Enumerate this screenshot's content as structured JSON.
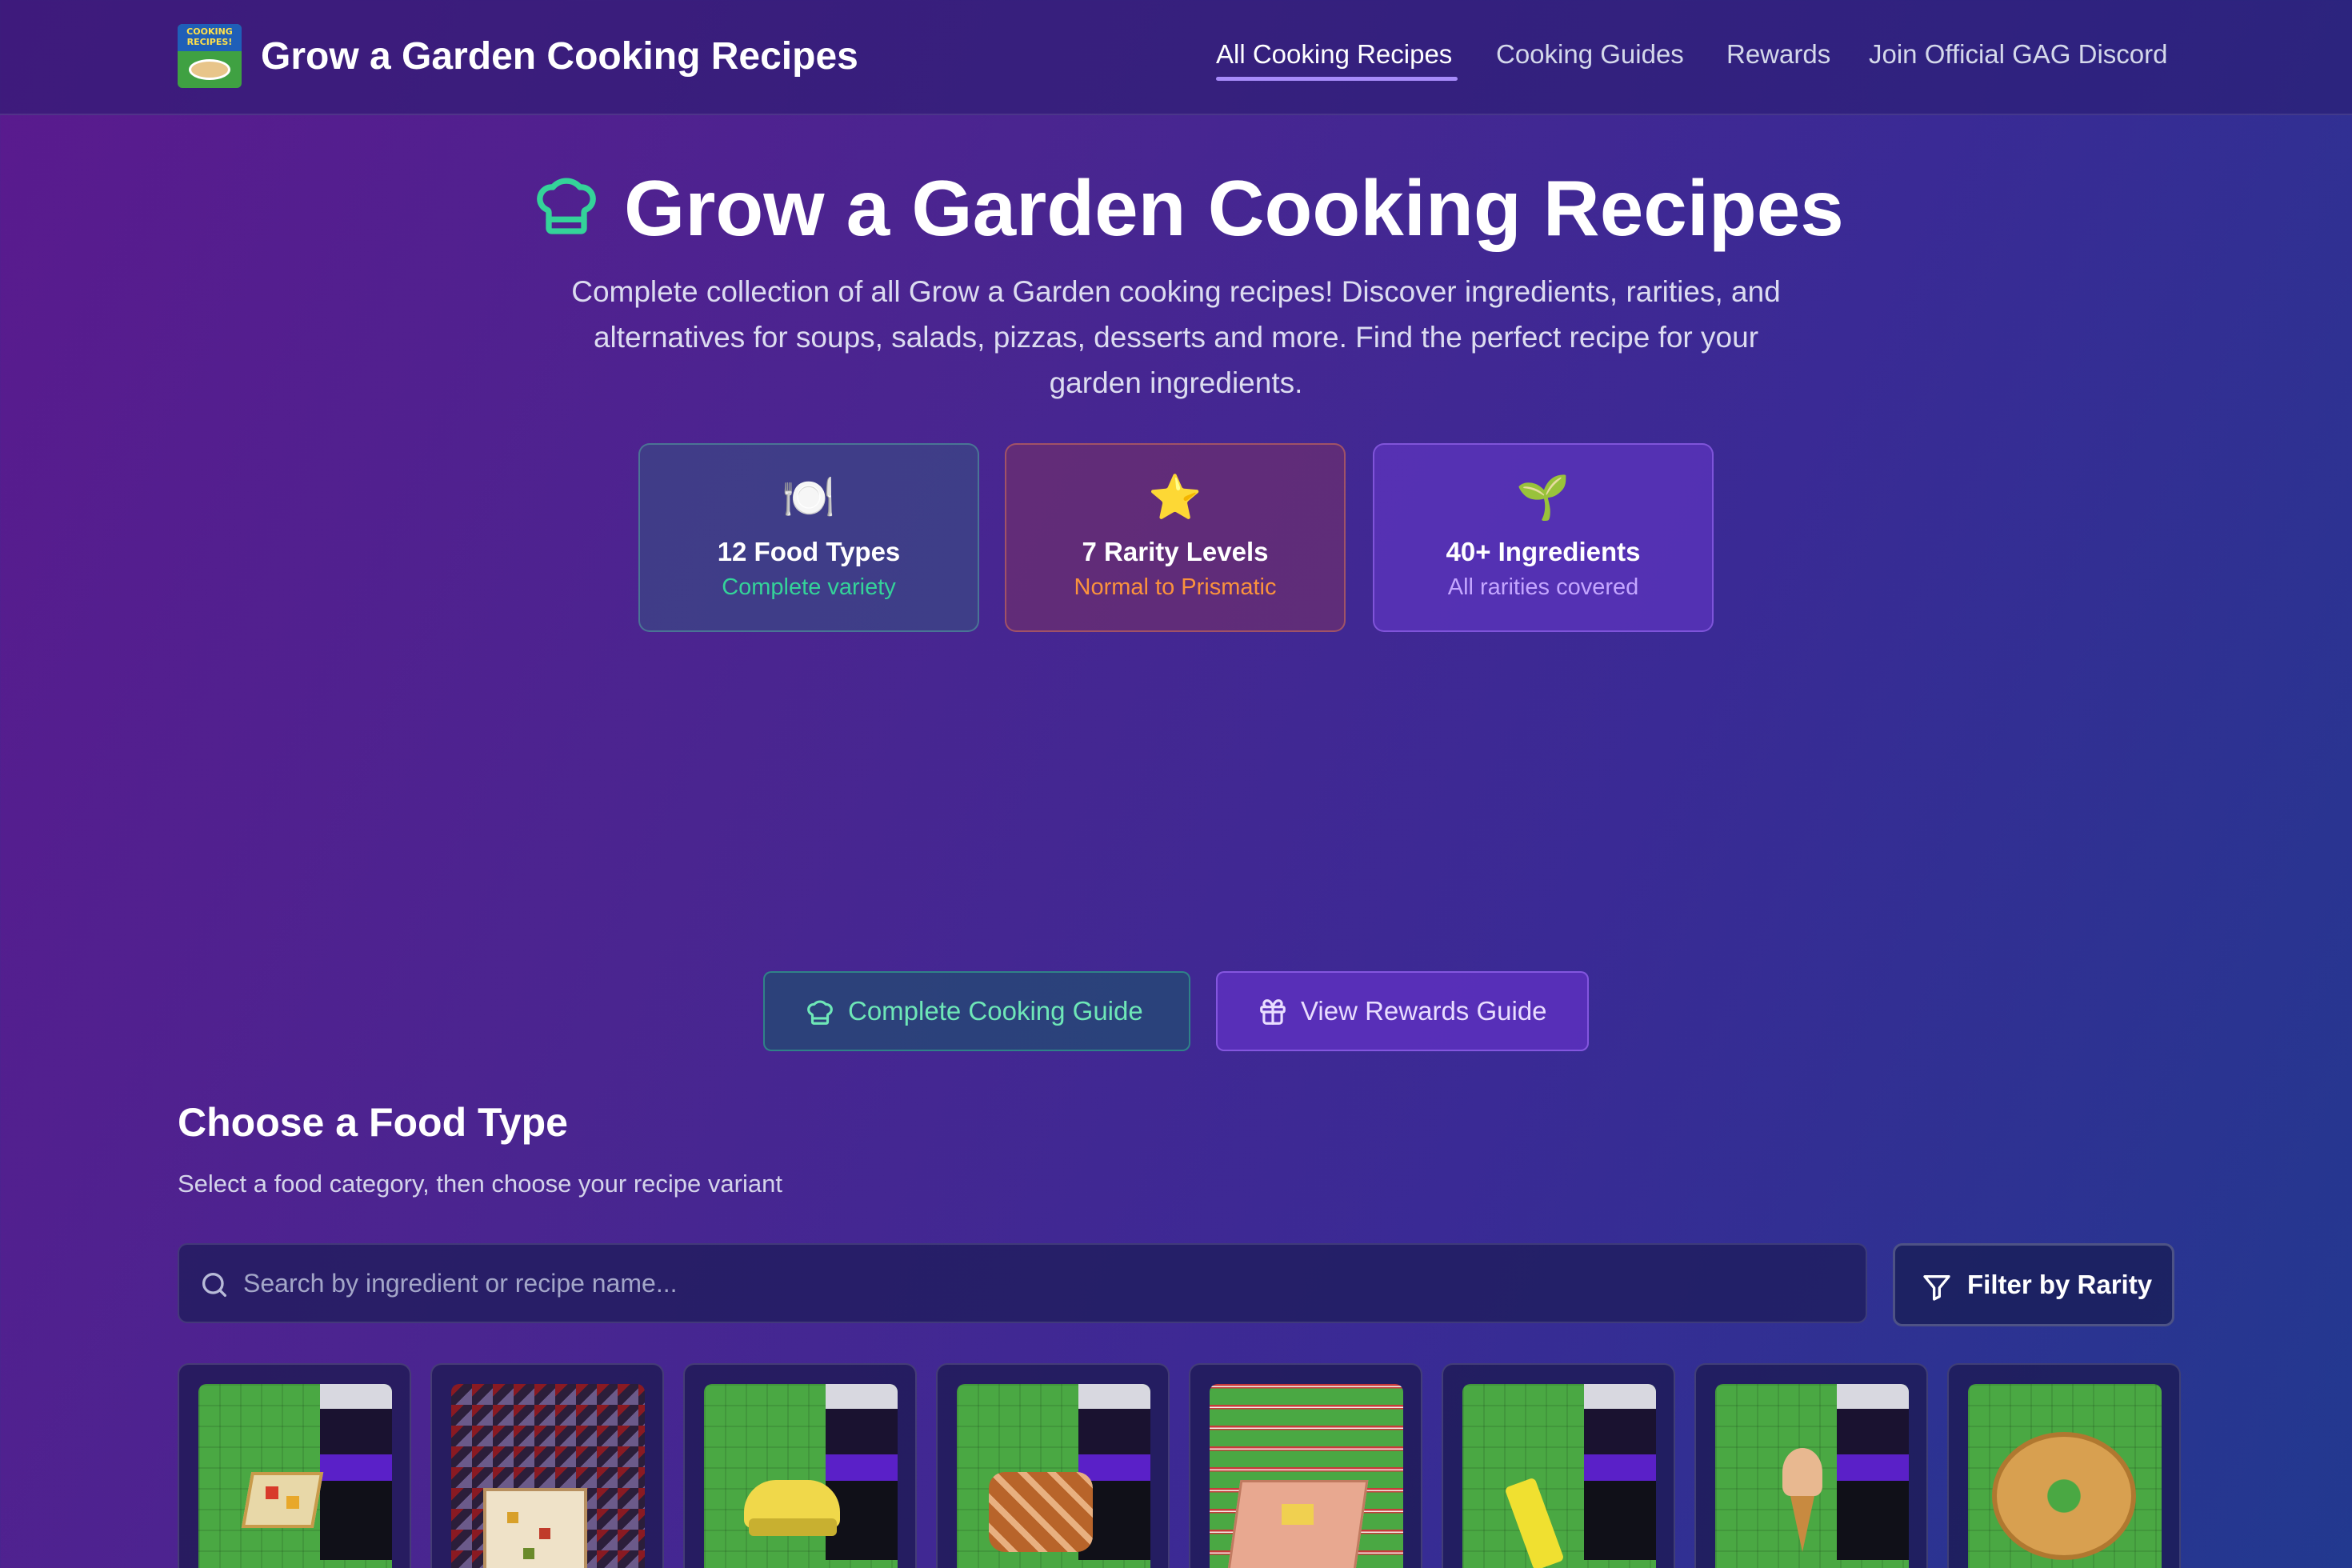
{
  "nav": {
    "logo_alt": "COOKING RECIPES!",
    "logo_text_line1": "COOKING",
    "logo_text_line2": "RECIPES!",
    "brand": "Grow a Garden Cooking Recipes",
    "links": [
      {
        "label": "All Cooking Recipes",
        "active": true
      },
      {
        "label": "Cooking Guides",
        "active": false
      },
      {
        "label": "Rewards",
        "active": false
      },
      {
        "label": "Join Official GAG Discord",
        "active": false
      }
    ]
  },
  "hero": {
    "icon": "chef-hat-icon",
    "title": "Grow a Garden Cooking Recipes",
    "description": "Complete collection of all Grow a Garden cooking recipes! Discover ingredients, rarities, and alternatives for soups, salads, pizzas, desserts and more. Find the perfect recipe for your garden ingredients."
  },
  "stats": [
    {
      "emoji": "🍽️",
      "title": "12 Food Types",
      "subtitle": "Complete variety",
      "accent": "#34d399"
    },
    {
      "emoji": "⭐",
      "title": "7 Rarity Levels",
      "subtitle": "Normal to Prismatic",
      "accent": "#fb923c"
    },
    {
      "emoji": "🌱",
      "title": "40+ Ingredients",
      "subtitle": "All rarities covered",
      "accent": "#c4a6ff"
    }
  ],
  "actions": {
    "guide_label": "Complete Cooking Guide",
    "rewards_label": "View Rewards Guide"
  },
  "section": {
    "title": "Choose a Food Type",
    "subtitle": "Select a food category, then choose your recipe variant"
  },
  "search": {
    "placeholder": "Search by ingredient or recipe name...",
    "value": ""
  },
  "filter": {
    "label": "Filter by Rarity"
  },
  "food_cards": [
    {
      "name": "food-card-1"
    },
    {
      "name": "food-card-2"
    },
    {
      "name": "food-card-3"
    },
    {
      "name": "food-card-4"
    },
    {
      "name": "food-card-5"
    },
    {
      "name": "food-card-6"
    },
    {
      "name": "food-card-7"
    },
    {
      "name": "food-card-8"
    }
  ],
  "colors": {
    "accent_green": "#34d399",
    "accent_orange": "#fb923c",
    "accent_purple": "#a78bfa"
  }
}
